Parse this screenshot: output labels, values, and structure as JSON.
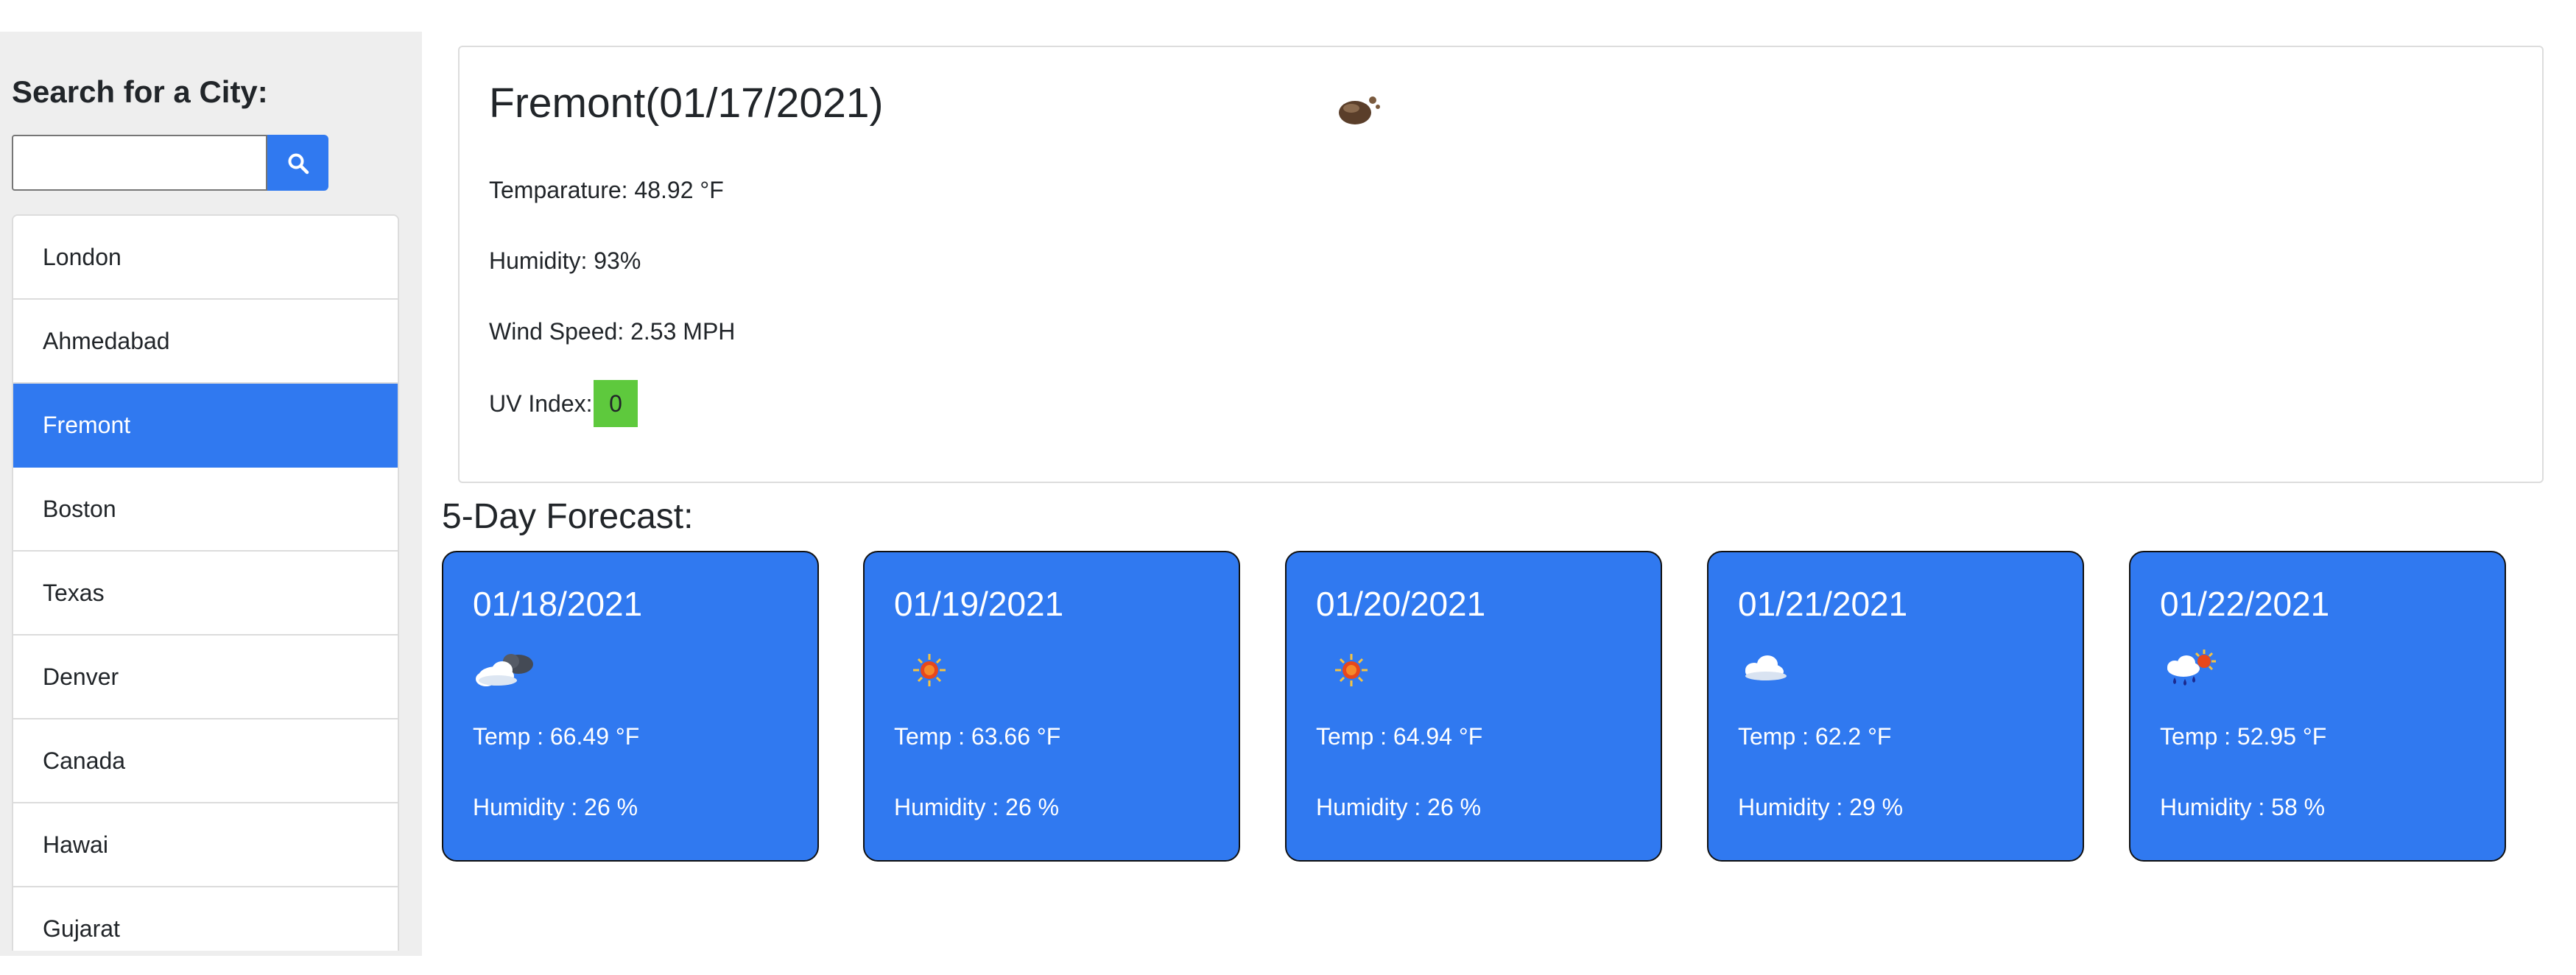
{
  "search": {
    "title": "Search for a City:",
    "input_value": "",
    "placeholder": "",
    "button_icon": "search-icon"
  },
  "cities": [
    {
      "label": "London",
      "active": false
    },
    {
      "label": "Ahmedabad",
      "active": false
    },
    {
      "label": "Fremont",
      "active": true
    },
    {
      "label": "Boston",
      "active": false
    },
    {
      "label": "Texas",
      "active": false
    },
    {
      "label": "Denver",
      "active": false
    },
    {
      "label": "Canada",
      "active": false
    },
    {
      "label": "Hawai",
      "active": false
    },
    {
      "label": "Gujarat",
      "active": false
    }
  ],
  "current": {
    "title": "Fremont(01/17/2021)",
    "icon": "fog-icon",
    "temperature": "Temparature: 48.92 °F",
    "humidity": "Humidity: 93%",
    "wind": "Wind Speed: 2.53 MPH",
    "uv_label": "UV Index:",
    "uv_value": "0",
    "uv_color": "#5ec93d"
  },
  "forecast": {
    "heading": "5-Day Forecast:",
    "days": [
      {
        "date": "01/18/2021",
        "icon": "partly-cloudy-night-icon",
        "temp": "Temp : 66.49 °F",
        "humidity": "Humidity : 26 %"
      },
      {
        "date": "01/19/2021",
        "icon": "sun-icon",
        "temp": "Temp : 63.66 °F",
        "humidity": "Humidity : 26 %"
      },
      {
        "date": "01/20/2021",
        "icon": "sun-icon",
        "temp": "Temp : 64.94 °F",
        "humidity": "Humidity : 26 %"
      },
      {
        "date": "01/21/2021",
        "icon": "cloud-icon",
        "temp": "Temp : 62.2 °F",
        "humidity": "Humidity : 29 %"
      },
      {
        "date": "01/22/2021",
        "icon": "rain-sun-icon",
        "temp": "Temp : 52.95 °F",
        "humidity": "Humidity : 58 %"
      }
    ]
  },
  "colors": {
    "accent": "#3079f0",
    "sidebar_bg": "#eeeeee",
    "uv_low": "#5ec93d"
  }
}
